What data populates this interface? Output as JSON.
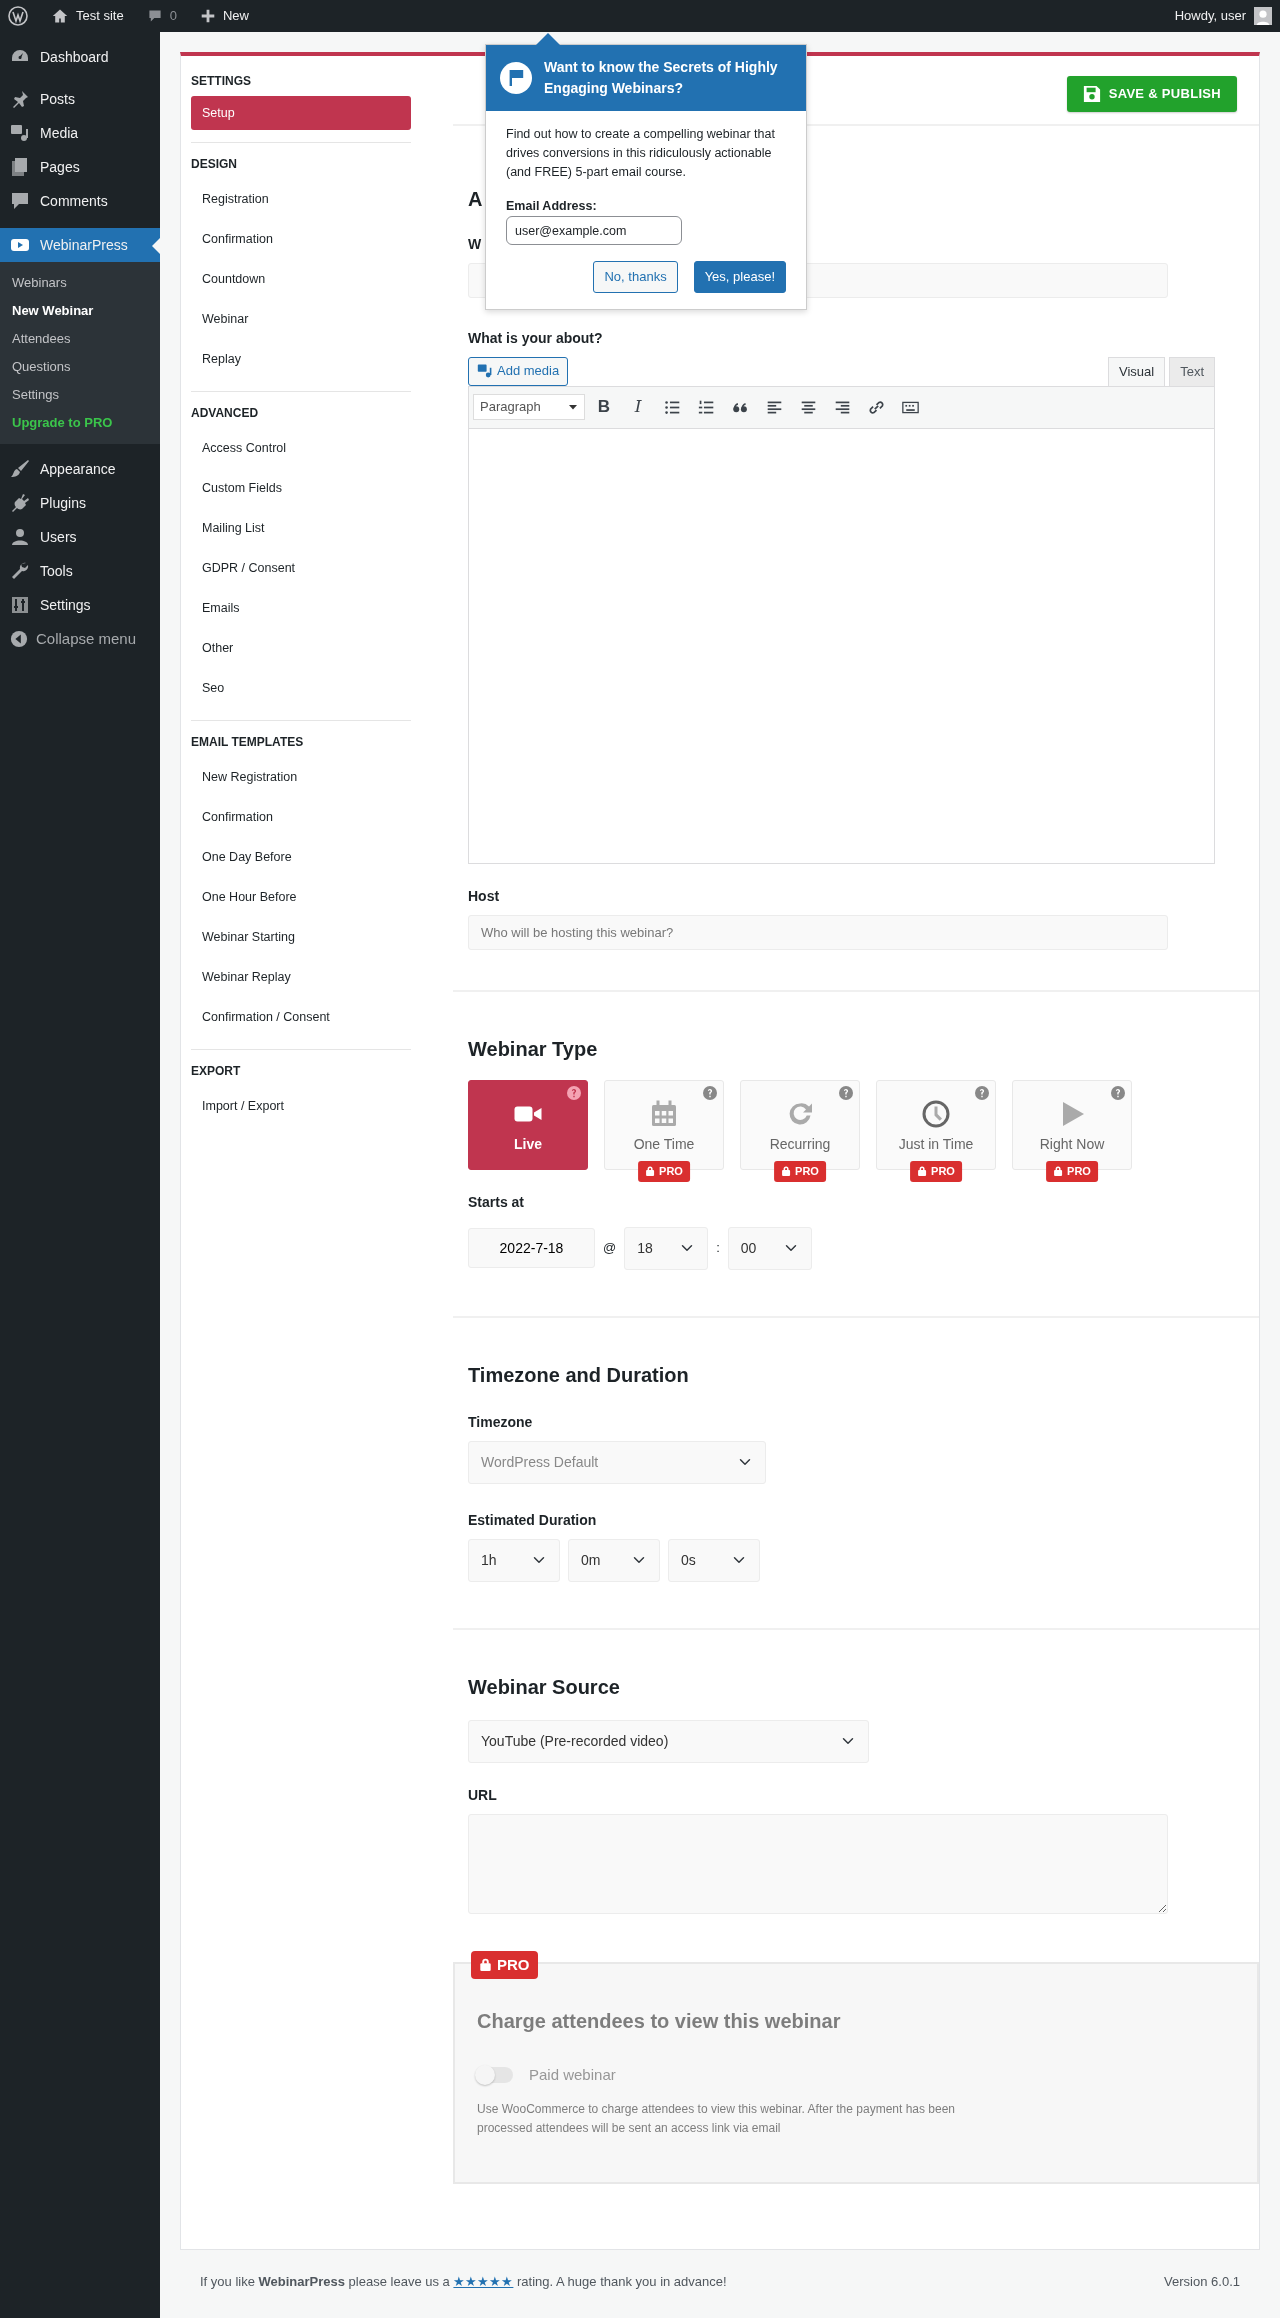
{
  "admin_bar": {
    "site": "Test site",
    "comments": "0",
    "new": "New",
    "greeting": "Howdy, user"
  },
  "sidebar": {
    "items": [
      {
        "label": "Dashboard",
        "selected": false
      },
      {
        "label": "Posts",
        "selected": false
      },
      {
        "label": "Media",
        "selected": false
      },
      {
        "label": "Pages",
        "selected": false
      },
      {
        "label": "Comments",
        "selected": false
      },
      {
        "label": "WebinarPress",
        "selected": true,
        "children": [
          {
            "label": "Webinars",
            "selected": false,
            "kind": "link"
          },
          {
            "label": "New Webinar",
            "selected": true,
            "kind": "link"
          },
          {
            "label": "Attendees",
            "selected": false,
            "kind": "link"
          },
          {
            "label": "Questions",
            "selected": false,
            "kind": "link"
          },
          {
            "label": "Settings",
            "selected": false,
            "kind": "link"
          },
          {
            "label": "Upgrade to PRO",
            "selected": false,
            "kind": "upgrade"
          }
        ]
      },
      {
        "label": "Appearance",
        "selected": false
      },
      {
        "label": "Plugins",
        "selected": false
      },
      {
        "label": "Users",
        "selected": false
      },
      {
        "label": "Tools",
        "selected": false
      },
      {
        "label": "Settings",
        "selected": false
      }
    ],
    "collapse": "Collapse menu"
  },
  "settings_nav": [
    {
      "title": "SETTINGS",
      "items": [
        {
          "label": "Setup",
          "selected": true
        }
      ]
    },
    {
      "title": "DESIGN",
      "items": [
        {
          "label": "Registration",
          "selected": false
        },
        {
          "label": "Confirmation",
          "selected": false
        },
        {
          "label": "Countdown",
          "selected": false
        },
        {
          "label": "Webinar",
          "selected": false
        },
        {
          "label": "Replay",
          "selected": false
        }
      ]
    },
    {
      "title": "ADVANCED",
      "items": [
        {
          "label": "Access Control",
          "selected": false
        },
        {
          "label": "Custom Fields",
          "selected": false
        },
        {
          "label": "Mailing List",
          "selected": false
        },
        {
          "label": "GDPR / Consent",
          "selected": false
        },
        {
          "label": "Emails",
          "selected": false
        },
        {
          "label": "Other",
          "selected": false
        },
        {
          "label": "Seo",
          "selected": false
        }
      ]
    },
    {
      "title": "EMAIL TEMPLATES",
      "items": [
        {
          "label": "New Registration",
          "selected": false
        },
        {
          "label": "Confirmation",
          "selected": false
        },
        {
          "label": "One Day Before",
          "selected": false
        },
        {
          "label": "One Hour Before",
          "selected": false
        },
        {
          "label": "Webinar Starting",
          "selected": false
        },
        {
          "label": "Webinar Replay",
          "selected": false
        },
        {
          "label": "Confirmation / Consent",
          "selected": false
        }
      ]
    },
    {
      "title": "EXPORT",
      "items": [
        {
          "label": "Import / Export",
          "selected": false
        }
      ]
    }
  ],
  "save_button": "SAVE & PUBLISH",
  "section_heading": "A",
  "title_label": "W",
  "about": {
    "label": "What is your about?",
    "add_media": "Add media",
    "tabs": [
      {
        "label": "Visual",
        "selected": true
      },
      {
        "label": "Text",
        "selected": false
      }
    ],
    "format": "Paragraph",
    "bold": "B",
    "italic": "I"
  },
  "host": {
    "label": "Host",
    "placeholder": "Who will be hosting this webinar?"
  },
  "webinar_type": {
    "heading": "Webinar Type",
    "types": [
      {
        "label": "Live",
        "selected": true
      },
      {
        "label": "One Time",
        "selected": false,
        "badge": "PRO"
      },
      {
        "label": "Recurring",
        "selected": false,
        "badge": "PRO"
      },
      {
        "label": "Just in Time",
        "selected": false,
        "badge": "PRO"
      },
      {
        "label": "Right Now",
        "selected": false,
        "badge": "PRO"
      }
    ]
  },
  "starts_at": {
    "label": "Starts at",
    "date": "2022-7-18",
    "at": "@",
    "hour": "18",
    "separator": ":",
    "minute": "00"
  },
  "timezone": {
    "heading": "Timezone and Duration",
    "label": "Timezone",
    "value": "WordPress Default",
    "duration_label": "Estimated Duration",
    "duration": [
      "1h",
      "0m",
      "0s"
    ]
  },
  "source": {
    "heading": "Webinar Source",
    "value": "YouTube (Pre-recorded video)",
    "url_label": "URL"
  },
  "paid": {
    "badge": "PRO",
    "heading": "Charge attendees to view this webinar",
    "toggle_label": "Paid webinar",
    "on": false,
    "disabled": true,
    "description": "Use WooCommerce to charge attendees to view this webinar. After the payment has been processed attendees will be sent an access link via email"
  },
  "popup": {
    "title": "Want to know the Secrets of Highly Engaging Webinars?",
    "body": "Find out how to create a compelling webinar that drives conversions in this ridiculously actionable (and FREE) 5-part email course.",
    "email_label": "Email Address:",
    "email": "user@example.com",
    "decline": "No, thanks",
    "accept": "Yes, please!"
  },
  "footer": {
    "before": "If you like **WebinarPress** please leave us a",
    "link": "★★★★★",
    "after": "rating. A huge thank you in advance!",
    "version": "Version 6.0.1"
  }
}
